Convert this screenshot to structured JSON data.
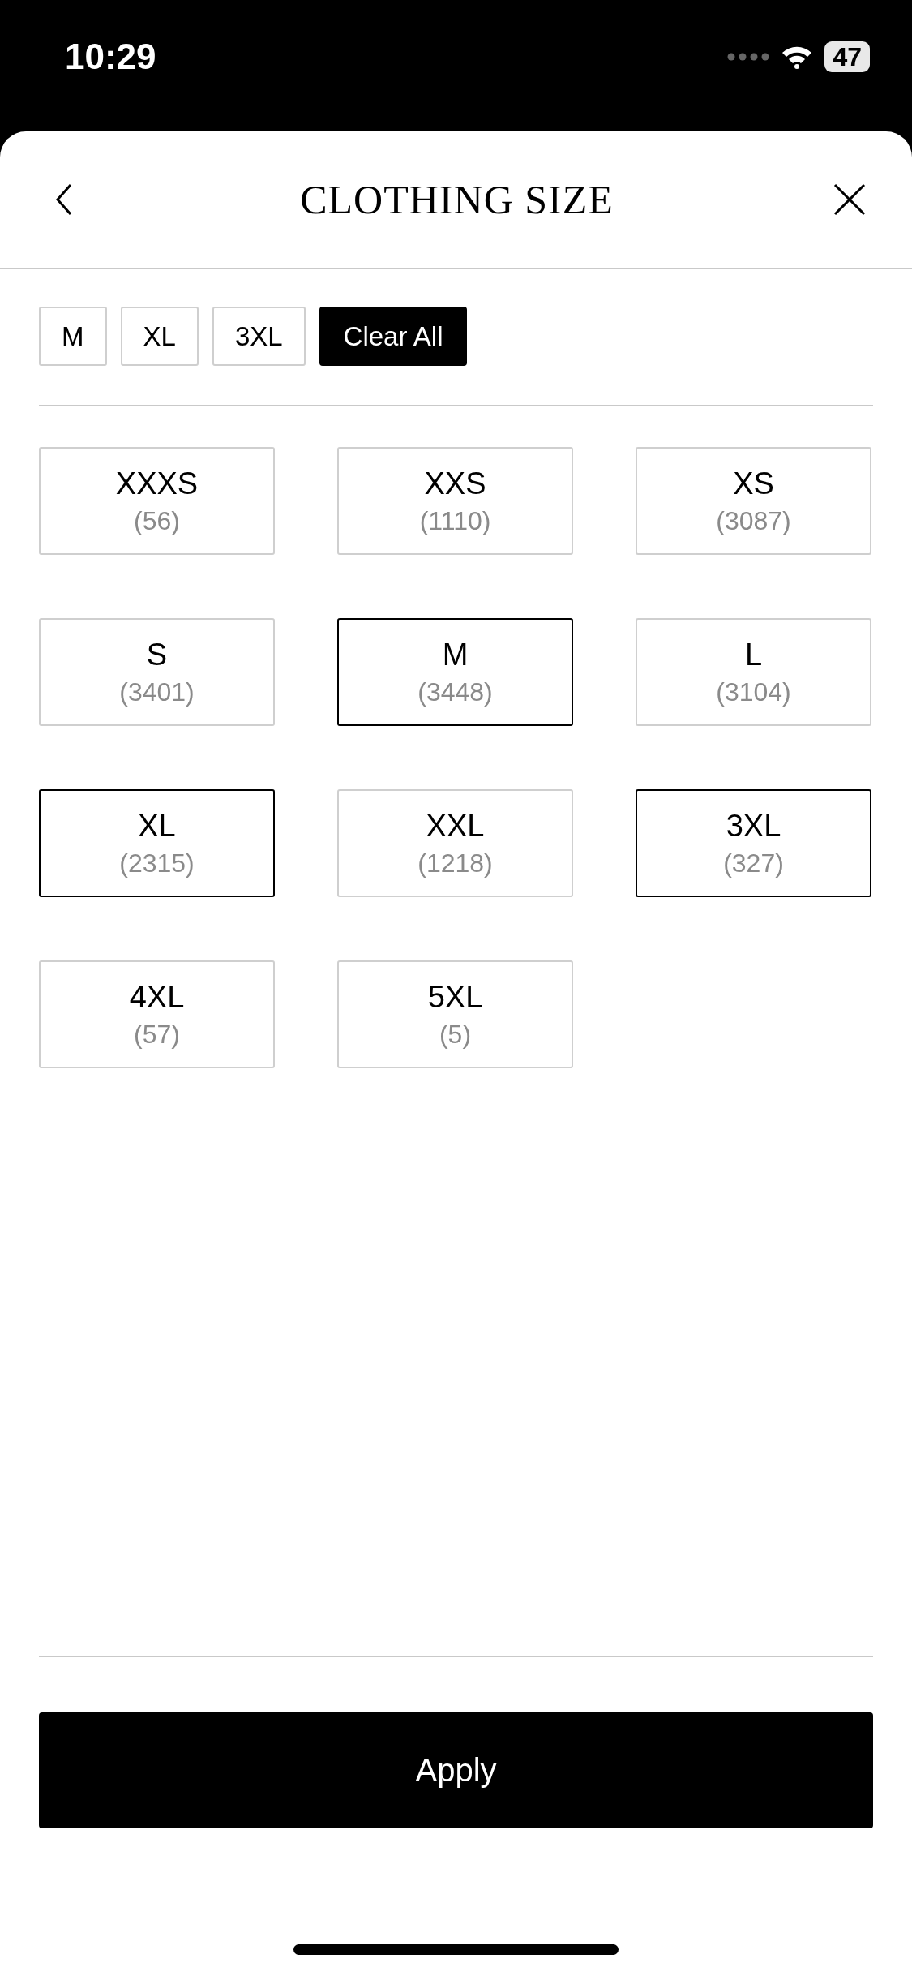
{
  "status_bar": {
    "time": "10:29",
    "battery": "47"
  },
  "header": {
    "title": "CLOTHING SIZE"
  },
  "selected_chips": [
    {
      "label": "M"
    },
    {
      "label": "XL"
    },
    {
      "label": "3XL"
    }
  ],
  "clear_button": "Clear All",
  "sizes": [
    {
      "label": "XXXS",
      "count": "(56)",
      "selected": false
    },
    {
      "label": "XXS",
      "count": "(1110)",
      "selected": false
    },
    {
      "label": "XS",
      "count": "(3087)",
      "selected": false
    },
    {
      "label": "S",
      "count": "(3401)",
      "selected": false
    },
    {
      "label": "M",
      "count": "(3448)",
      "selected": true
    },
    {
      "label": "L",
      "count": "(3104)",
      "selected": false
    },
    {
      "label": "XL",
      "count": "(2315)",
      "selected": true
    },
    {
      "label": "XXL",
      "count": "(1218)",
      "selected": false
    },
    {
      "label": "3XL",
      "count": "(327)",
      "selected": true
    },
    {
      "label": "4XL",
      "count": "(57)",
      "selected": false
    },
    {
      "label": "5XL",
      "count": "(5)",
      "selected": false
    }
  ],
  "apply_button": "Apply"
}
